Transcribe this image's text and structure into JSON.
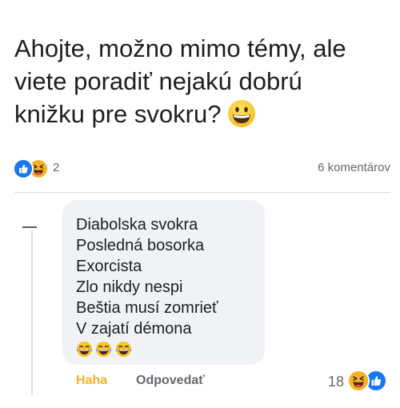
{
  "post": {
    "lines": [
      "Ahojte, možno mimo témy, ale",
      "viete poradiť nejakú dobrú",
      "knižku pre svokru?"
    ],
    "trailing_emoji": "grinning-face-icon"
  },
  "reactions": {
    "icons": [
      "like-icon",
      "haha-icon"
    ],
    "count": "2",
    "comments_label": "6 komentárov"
  },
  "comment": {
    "lines": [
      "Diabolska svokra",
      "Posledná bosorka",
      "Exorcista",
      "Zlo nikdy nespi",
      "Beštia musí zomrieť",
      "V zajatí démona"
    ],
    "emojis": [
      "laughing-tears-icon",
      "laughing-tears-icon",
      "laughing-tears-icon"
    ],
    "actions": {
      "haha_label": "Haha",
      "reply_label": "Odpovedať"
    },
    "reactions": {
      "count": "18",
      "icons": [
        "haha-icon",
        "like-icon"
      ]
    }
  },
  "colors": {
    "like_blue": "#1877f2",
    "haha_yellow": "#f7b125",
    "secondary_text": "#65676b",
    "bubble_bg": "#f0f2f5"
  }
}
